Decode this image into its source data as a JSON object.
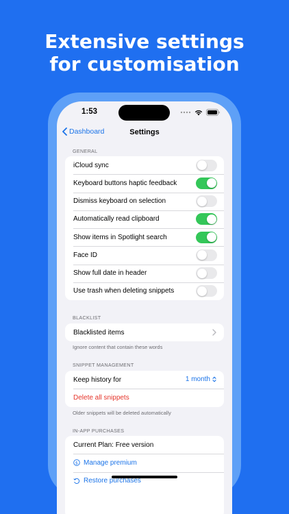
{
  "headline": {
    "line1": "Extensive settings",
    "line2": "for customisation"
  },
  "status_bar": {
    "time": "1:53"
  },
  "nav": {
    "back_label": "Dashboard",
    "title": "Settings"
  },
  "general": {
    "header": "GENERAL",
    "items": [
      {
        "label": "iCloud sync",
        "on": false
      },
      {
        "label": "Keyboard buttons haptic feedback",
        "on": true
      },
      {
        "label": "Dismiss keyboard on selection",
        "on": false
      },
      {
        "label": "Automatically read clipboard",
        "on": true
      },
      {
        "label": "Show items in Spotlight search",
        "on": true
      },
      {
        "label": "Face ID",
        "on": false
      },
      {
        "label": "Show full date in header",
        "on": false
      },
      {
        "label": "Use trash when deleting snippets",
        "on": false
      }
    ]
  },
  "blacklist": {
    "header": "BLACKLIST",
    "item_label": "Blacklisted items",
    "footer": "Ignore content that contain these words"
  },
  "snippet_management": {
    "header": "SNIPPET MANAGEMENT",
    "history_label": "Keep history for",
    "history_value": "1 month",
    "delete_label": "Delete all snippets",
    "footer": "Older snippets will be deleted automatically"
  },
  "purchases": {
    "header": "IN-APP PURCHASES",
    "plan_label": "Current Plan: Free version",
    "manage_label": "Manage premium",
    "restore_label": "Restore purchases"
  },
  "colors": {
    "background": "#1f6ff0",
    "accent": "#1a73e8",
    "toggle_on": "#34c759",
    "destructive": "#e5342a"
  }
}
